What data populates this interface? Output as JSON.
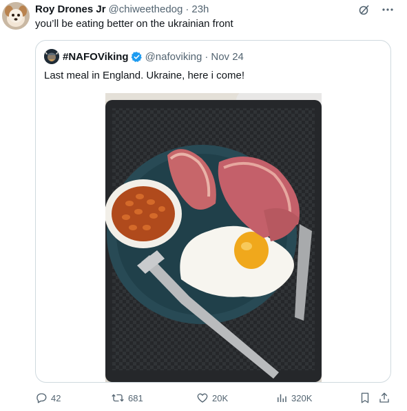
{
  "tweet": {
    "author_name": "Roy Drones Jr",
    "author_handle": "@chiweethedog",
    "separator": "·",
    "time": "23h",
    "text": "you’ll be eating better on the ukrainian front"
  },
  "quote": {
    "author_name": "#NAFOViking",
    "author_handle": "@nafoviking",
    "separator": "·",
    "date": "Nov 24",
    "text": "Last meal in England. Ukraine, here i come!"
  },
  "actions": {
    "replies": "42",
    "reposts": "681",
    "likes": "20K",
    "views": "320K"
  },
  "colors": {
    "text_primary": "#0f1419",
    "text_secondary": "#536471",
    "border": "#cfd9de",
    "verified_blue": "#1d9bf0"
  },
  "icons": [
    "grok-icon",
    "more-icon",
    "verified-badge-icon",
    "reply-icon",
    "repost-icon",
    "like-icon",
    "views-icon",
    "bookmark-icon",
    "share-icon"
  ]
}
